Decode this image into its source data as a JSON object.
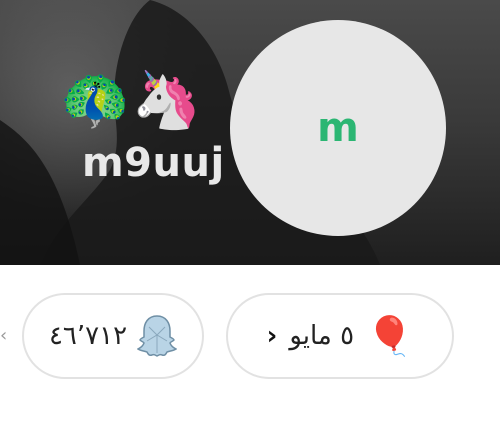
{
  "profile": {
    "emojis": [
      "🦚",
      "🦄"
    ],
    "username": "m9uuj",
    "avatar_letter": "m"
  },
  "stats": {
    "score": "٤٦٬٧١٢",
    "birthday": "٥ مايو"
  },
  "icons": {
    "score": "ghost-icon",
    "birthday": "balloon-icon",
    "chevron": "chevron-left-icon"
  },
  "colors": {
    "avatar_letter": "#2bb673",
    "avatar_bg": "#e7e7e7",
    "pill_border": "#e2e2e2"
  }
}
